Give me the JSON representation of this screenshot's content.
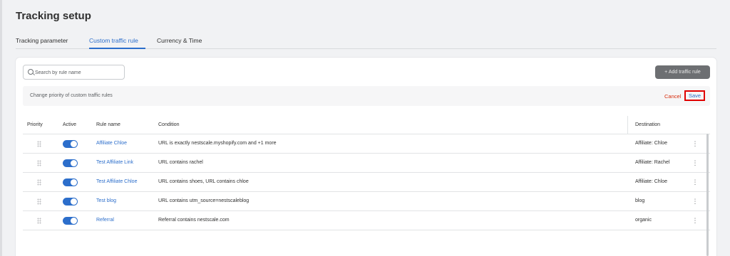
{
  "page": {
    "title": "Tracking setup"
  },
  "tabs": [
    {
      "label": "Tracking parameter",
      "active": false
    },
    {
      "label": "Custom traffic rule",
      "active": true
    },
    {
      "label": "Currency & Time",
      "active": false
    }
  ],
  "search": {
    "placeholder": "Search by rule name",
    "value": "",
    "icon": "search-icon"
  },
  "toolbar": {
    "add_label": "+ Add traffic rule"
  },
  "priority_bar": {
    "label": "Change priority of custom traffic rules",
    "cancel_label": "Cancel",
    "save_label": "Save"
  },
  "table": {
    "headers": {
      "priority": "Priority",
      "active": "Active",
      "rule_name": "Rule name",
      "condition": "Condition",
      "destination": "Destination"
    },
    "rows": [
      {
        "name": "Affiliate Chloe",
        "condition": "URL is exactly nestscale.myshopify.com and +1 more",
        "destination": "Affiliate: Chloe",
        "active": true
      },
      {
        "name": "Test Affiliate Link",
        "condition": "URL contains rachel",
        "destination": "Affiliate: Rachel",
        "active": true
      },
      {
        "name": "Test Affiliate Chloe",
        "condition": "URL contains shoes, URL contains chloe",
        "destination": "Affiliate: Chloe",
        "active": true
      },
      {
        "name": "Test blog",
        "condition": "URL contains utm_source=nestscaleblog",
        "destination": "blog",
        "active": true
      },
      {
        "name": "Referral",
        "condition": "Referral contains nestscale.com",
        "destination": "organic",
        "active": true
      }
    ]
  },
  "colors": {
    "accent": "#2c6ecb",
    "danger": "#d72c0d",
    "highlight": "#e00000"
  }
}
